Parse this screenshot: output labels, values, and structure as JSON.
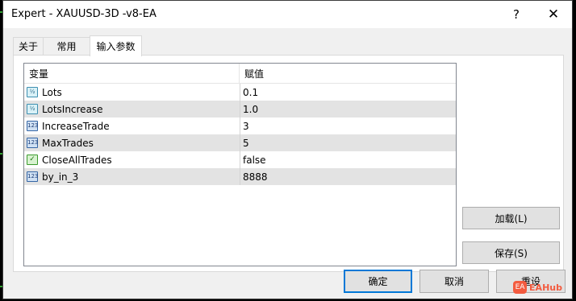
{
  "window": {
    "title": "Expert - XAUUSD-3D -v8-EA",
    "help_glyph": "?",
    "close_glyph": "✕"
  },
  "tabs": [
    {
      "label": "关于",
      "active": false
    },
    {
      "label": "常用",
      "active": false
    },
    {
      "label": "输入参数",
      "active": true
    }
  ],
  "grid": {
    "headers": {
      "variable": "变量",
      "value": "赋值"
    },
    "rows": [
      {
        "icon": "fraction-icon",
        "icon_glyph": "½",
        "name": "Lots",
        "value": "0.1"
      },
      {
        "icon": "fraction-icon",
        "icon_glyph": "½",
        "name": "LotsIncrease",
        "value": "1.0"
      },
      {
        "icon": "integer-icon",
        "icon_glyph": "123",
        "name": "IncreaseTrade",
        "value": "3"
      },
      {
        "icon": "integer-icon",
        "icon_glyph": "123",
        "name": "MaxTrades",
        "value": "5"
      },
      {
        "icon": "boolean-icon",
        "icon_glyph": "✓",
        "name": "CloseAllTrades",
        "value": "false"
      },
      {
        "icon": "integer-icon",
        "icon_glyph": "123",
        "name": "by_in_3",
        "value": "8888"
      }
    ]
  },
  "side_buttons": {
    "load": "加载(L)",
    "save": "保存(S)"
  },
  "footer_buttons": {
    "ok": "确定",
    "cancel": "取消",
    "reset": "重设"
  },
  "watermark": {
    "badge": "EA",
    "text": "EAHub"
  },
  "colors": {
    "accent": "#0078d7",
    "alt_row": "#e3e3e3",
    "watermark": "#f35b3f"
  }
}
